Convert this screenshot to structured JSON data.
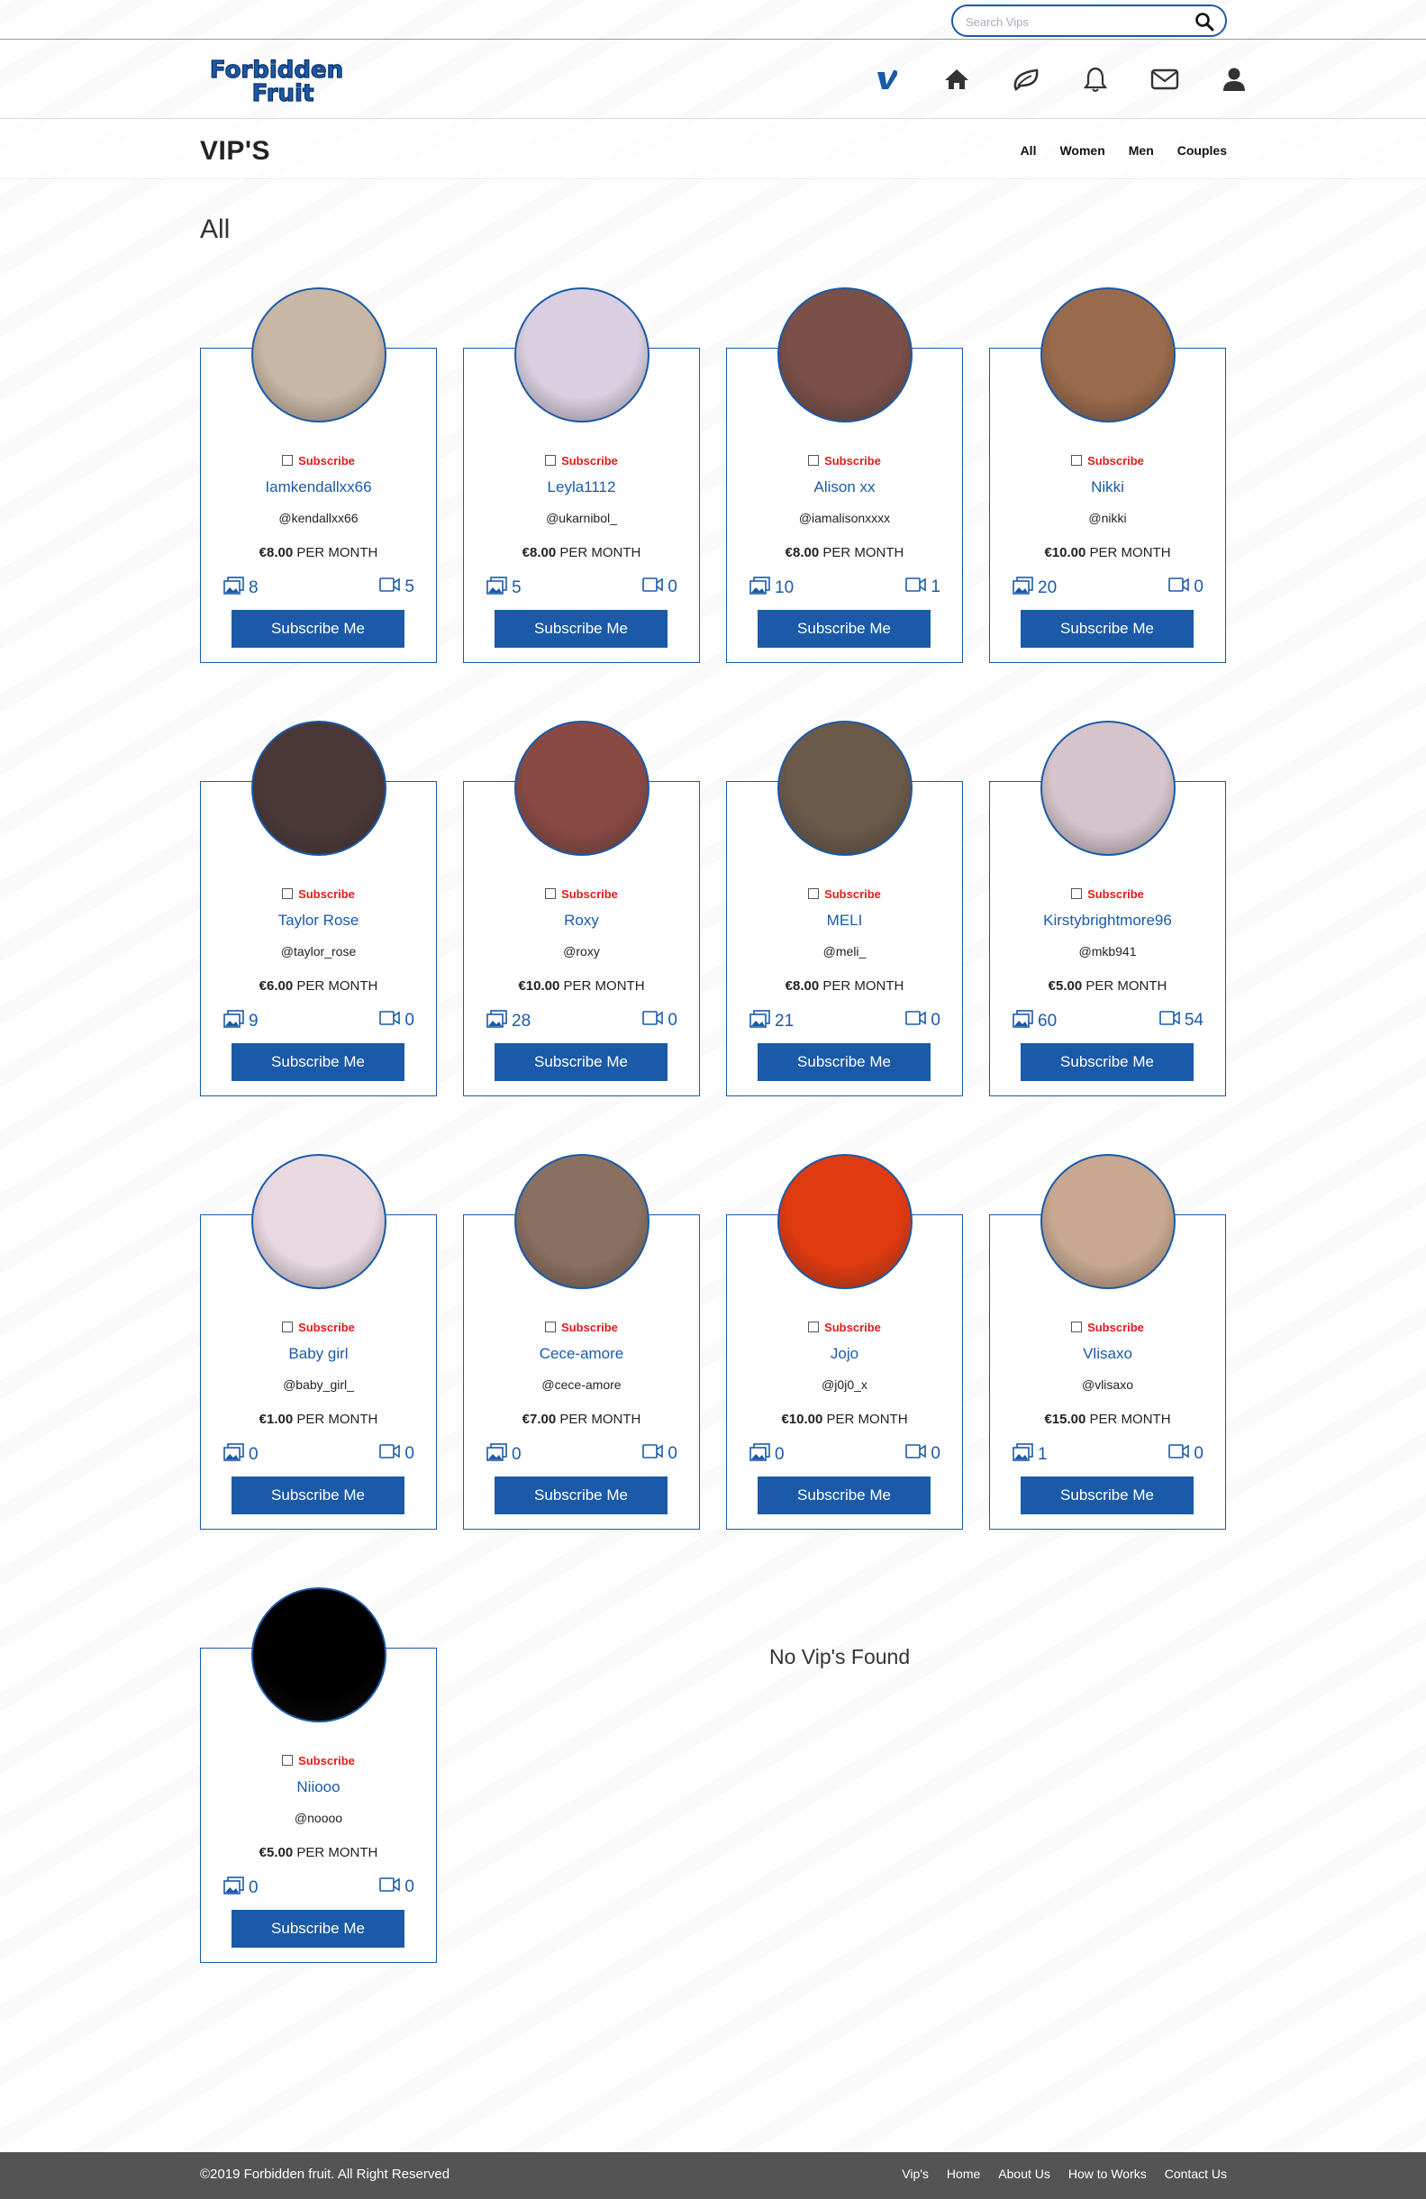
{
  "search": {
    "placeholder": "Search Vips"
  },
  "header": {
    "logo_line1": "Forbidden",
    "logo_line2": "Fruit",
    "nav": [
      "vip-icon",
      "home-icon",
      "feed-icon",
      "bell-icon",
      "mail-icon",
      "user-icon"
    ]
  },
  "subheader": {
    "title": "VIP'S",
    "filters": [
      "All",
      "Women",
      "Men",
      "Couples"
    ]
  },
  "section_title": "All",
  "colors": {
    "accent": "#1a5aa8",
    "subscribe_red": "#e21b1b",
    "footer": "#545454"
  },
  "cards": [
    {
      "subscribe": "Subscribe",
      "name": "Iamkendallxx66",
      "handle": "@kendallxx66",
      "price": "€8.00",
      "per": "PER MONTH",
      "photos": "8",
      "videos": "5",
      "button": "Subscribe Me"
    },
    {
      "subscribe": "Subscribe",
      "name": "Leyla1112",
      "handle": "@ukarnibol_",
      "price": "€8.00",
      "per": "PER MONTH",
      "photos": "5",
      "videos": "0",
      "button": "Subscribe Me"
    },
    {
      "subscribe": "Subscribe",
      "name": "Alison xx",
      "handle": "@iamalisonxxxx",
      "price": "€8.00",
      "per": "PER MONTH",
      "photos": "10",
      "videos": "1",
      "button": "Subscribe Me"
    },
    {
      "subscribe": "Subscribe",
      "name": "Nikki",
      "handle": "@nikki",
      "price": "€10.00",
      "per": "PER MONTH",
      "photos": "20",
      "videos": "0",
      "button": "Subscribe Me"
    },
    {
      "subscribe": "Subscribe",
      "name": "Taylor Rose",
      "handle": "@taylor_rose",
      "price": "€6.00",
      "per": "PER MONTH",
      "photos": "9",
      "videos": "0",
      "button": "Subscribe Me"
    },
    {
      "subscribe": "Subscribe",
      "name": "Roxy",
      "handle": "@roxy",
      "price": "€10.00",
      "per": "PER MONTH",
      "photos": "28",
      "videos": "0",
      "button": "Subscribe Me"
    },
    {
      "subscribe": "Subscribe",
      "name": "MELI",
      "handle": "@meli_",
      "price": "€8.00",
      "per": "PER MONTH",
      "photos": "21",
      "videos": "0",
      "button": "Subscribe Me"
    },
    {
      "subscribe": "Subscribe",
      "name": "Kirstybrightmore96",
      "handle": "@mkb941",
      "price": "€5.00",
      "per": "PER MONTH",
      "photos": "60",
      "videos": "54",
      "button": "Subscribe Me"
    },
    {
      "subscribe": "Subscribe",
      "name": "Baby girl",
      "handle": "@baby_girl_",
      "price": "€1.00",
      "per": "PER MONTH",
      "photos": "0",
      "videos": "0",
      "button": "Subscribe Me"
    },
    {
      "subscribe": "Subscribe",
      "name": "Cece-amore",
      "handle": "@cece-amore",
      "price": "€7.00",
      "per": "PER MONTH",
      "photos": "0",
      "videos": "0",
      "button": "Subscribe Me"
    },
    {
      "subscribe": "Subscribe",
      "name": "Jojo",
      "handle": "@j0j0_x",
      "price": "€10.00",
      "per": "PER MONTH",
      "photos": "0",
      "videos": "0",
      "button": "Subscribe Me"
    },
    {
      "subscribe": "Subscribe",
      "name": "Vlisaxo",
      "handle": "@vlisaxo",
      "price": "€15.00",
      "per": "PER MONTH",
      "photos": "1",
      "videos": "0",
      "button": "Subscribe Me"
    },
    {
      "subscribe": "Subscribe",
      "name": "Niiooo",
      "handle": "@noooo",
      "price": "€5.00",
      "per": "PER MONTH",
      "photos": "0",
      "videos": "0",
      "button": "Subscribe Me"
    }
  ],
  "avatar_colors": [
    "#c9b7a5",
    "#d9cfe0",
    "#7a5048",
    "#9a6a4c",
    "#4a3838",
    "#8a4a44",
    "#6b5a4a",
    "#d6c4cc",
    "#e8d8e0",
    "#8a7060",
    "#e03a10",
    "#c8a890",
    "#000000"
  ],
  "no_vips": "No Vip's Found",
  "footer": {
    "copyright": "©2019 Forbidden fruit. All Right Reserved",
    "links": [
      "Vip's",
      "Home",
      "About Us",
      "How to Works",
      "Contact Us"
    ]
  }
}
